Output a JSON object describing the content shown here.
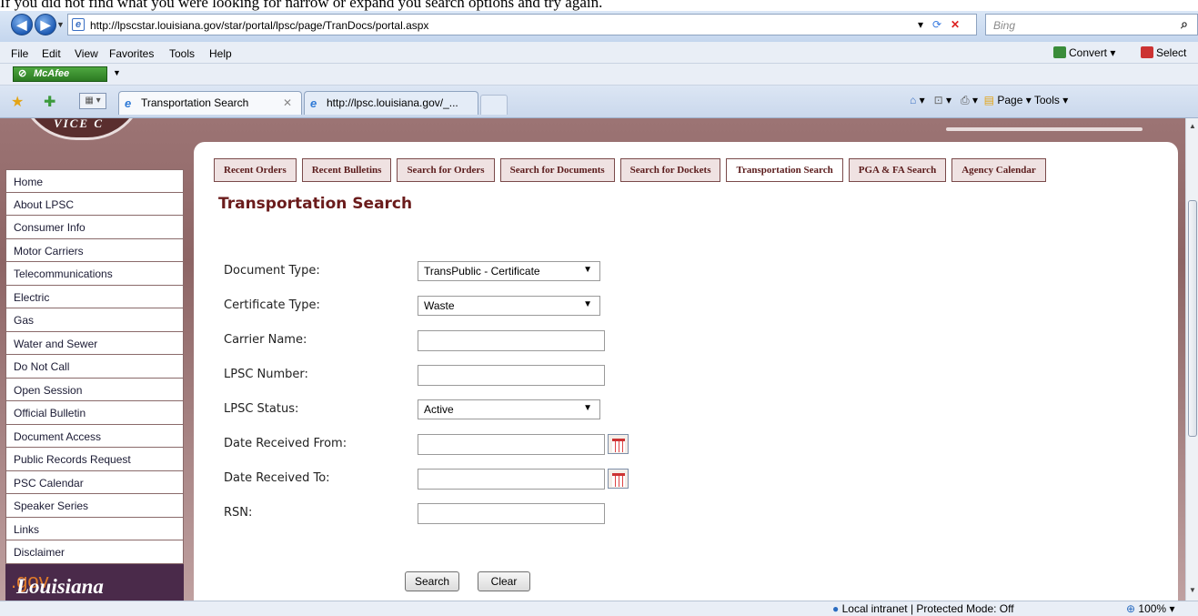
{
  "top_text": "If you did not find what you were looking for narrow or expand you search options and try again.",
  "browser": {
    "url": "http://lpscstar.louisiana.gov/star/portal/lpsc/page/TranDocs/portal.aspx",
    "search_placeholder": "Bing",
    "menu": [
      "File",
      "Edit",
      "View",
      "Favorites",
      "Tools",
      "Help"
    ],
    "convert_label": "Convert",
    "select_label": "Select",
    "mcafee_label": "McAfee",
    "tabs": [
      {
        "label": "Transportation Search",
        "close": "✕"
      },
      {
        "label": "http://lpsc.louisiana.gov/_..."
      }
    ],
    "command_bar": "Page ▾  Tools ▾",
    "status_zone": "Local intranet | Protected Mode: Off",
    "zoom": "100%"
  },
  "site": {
    "seal_text": "VICE C"
  },
  "sidebar": {
    "items": [
      "Home",
      "About LPSC",
      "Consumer Info",
      "Motor Carriers",
      "Telecommunications",
      "Electric",
      "Gas",
      "Water and Sewer",
      "Do Not Call",
      "Open Session",
      "Official Bulletin",
      "Document Access",
      "Public Records Request",
      "PSC Calendar",
      "Speaker Series",
      "Links",
      "Disclaimer"
    ],
    "logo_main": "Louisiana",
    "logo_suffix": ".gov"
  },
  "navtabs": [
    "Recent Orders",
    "Recent Bulletins",
    "Search for Orders",
    "Search for Documents",
    "Search for Dockets",
    "Transportation Search",
    "PGA & FA Search",
    "Agency Calendar"
  ],
  "page_title": "Transportation Search",
  "form": {
    "document_type_label": "Document Type:",
    "document_type_value": "TransPublic - Certificate",
    "certificate_type_label": "Certificate Type:",
    "certificate_type_value": "Waste",
    "carrier_name_label": "Carrier Name:",
    "lpsc_number_label": "LPSC Number:",
    "lpsc_status_label": "LPSC Status:",
    "lpsc_status_value": "Active",
    "date_from_label": "Date Received From:",
    "date_to_label": "Date Received To:",
    "rsn_label": "RSN:",
    "search_button": "Search",
    "clear_button": "Clear"
  }
}
